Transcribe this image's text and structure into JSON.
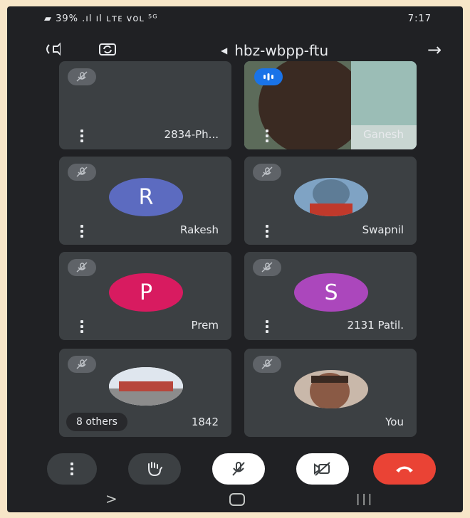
{
  "status_bar": {
    "left_text": "▰ 39% .ıl ıl ʟᴛᴇ ᴠᴏʟ ⁵ᴳ",
    "time": "7:17"
  },
  "call": {
    "meeting_code": "hbz-wbpp-ftu"
  },
  "tiles": [
    {
      "name": "2834-Ph...",
      "avatar_letter": "",
      "avatar_color": "#1f1f1f"
    },
    {
      "name": "Ganesh",
      "avatar_letter": "",
      "avatar_color": "#7aa6a2"
    },
    {
      "name": "Rakesh",
      "avatar_letter": "R",
      "avatar_color": "#5c6bc0"
    },
    {
      "name": "Swapnil",
      "avatar_letter": "",
      "avatar_color": "#6a8fb0"
    },
    {
      "name": "Prem",
      "avatar_letter": "P",
      "avatar_color": "#d81b60"
    },
    {
      "name": "2131 Patil.",
      "avatar_letter": "S",
      "avatar_color": "#ab47bc"
    },
    {
      "name": "1842",
      "avatar_letter": "",
      "avatar_color": "#4a4a4a"
    },
    {
      "name": "You",
      "avatar_letter": "",
      "avatar_color": "#7b5e57"
    }
  ],
  "others_chip": "8 others",
  "controls": {
    "end_call_color": "#ea4335"
  },
  "colors": {
    "background": "#202124",
    "tile": "#3c4043",
    "mute_badge": "#5f6368",
    "speaking_badge": "#1a73e8"
  }
}
